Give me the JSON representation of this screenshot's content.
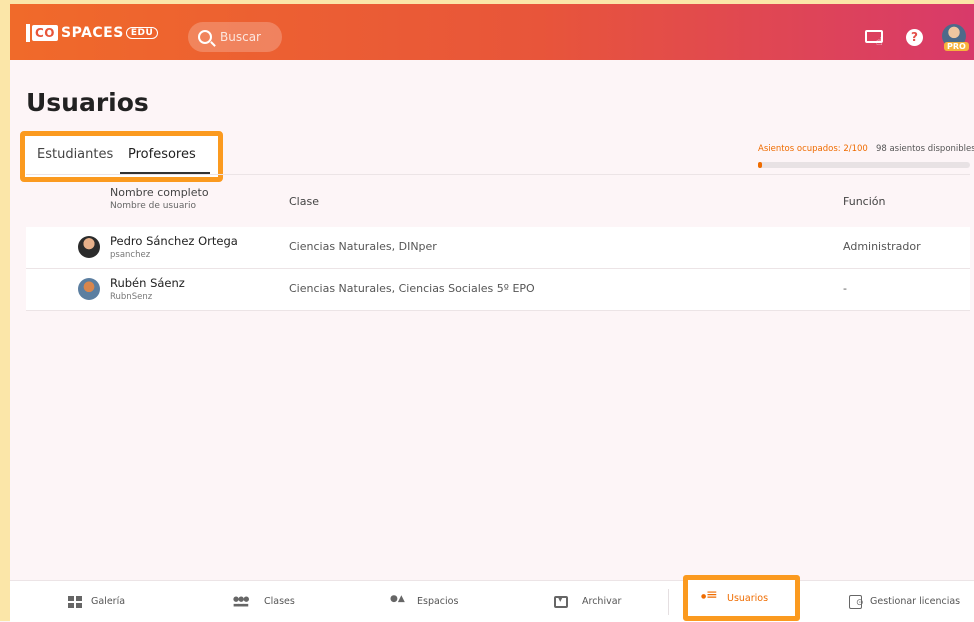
{
  "header": {
    "logo_co": "CO",
    "logo_spaces": "SPACES",
    "logo_edu": "EDU",
    "search_placeholder": "Buscar",
    "pro_badge": "PRO"
  },
  "page": {
    "title": "Usuarios",
    "tabs": [
      {
        "label": "Estudiantes",
        "active": false
      },
      {
        "label": "Profesores",
        "active": true
      }
    ],
    "seats": {
      "occupied_label": "Asientos ocupados: 2/100",
      "available_label": "98 asientos disponibles",
      "occupied_fraction": 0.02
    }
  },
  "table": {
    "headers": {
      "name": "Nombre completo",
      "username": "Nombre de usuario",
      "class": "Clase",
      "role": "Función"
    },
    "rows": [
      {
        "name": "Pedro Sánchez Ortega",
        "username": "psanchez",
        "class": "Ciencias Naturales, DINper",
        "role": "Administrador"
      },
      {
        "name": "Rubén Sáenz",
        "username": "RubnSenz",
        "class": "Ciencias Naturales, Ciencias Sociales 5º EPO",
        "role": "-"
      }
    ]
  },
  "bottom_nav": {
    "gallery": "Galería",
    "classes": "Clases",
    "spaces": "Espacios",
    "archive": "Archivar",
    "users": "Usuarios",
    "licenses": "Gestionar licencias"
  },
  "colors": {
    "accent": "#ef6c00",
    "highlight": "#fb9a1f"
  }
}
